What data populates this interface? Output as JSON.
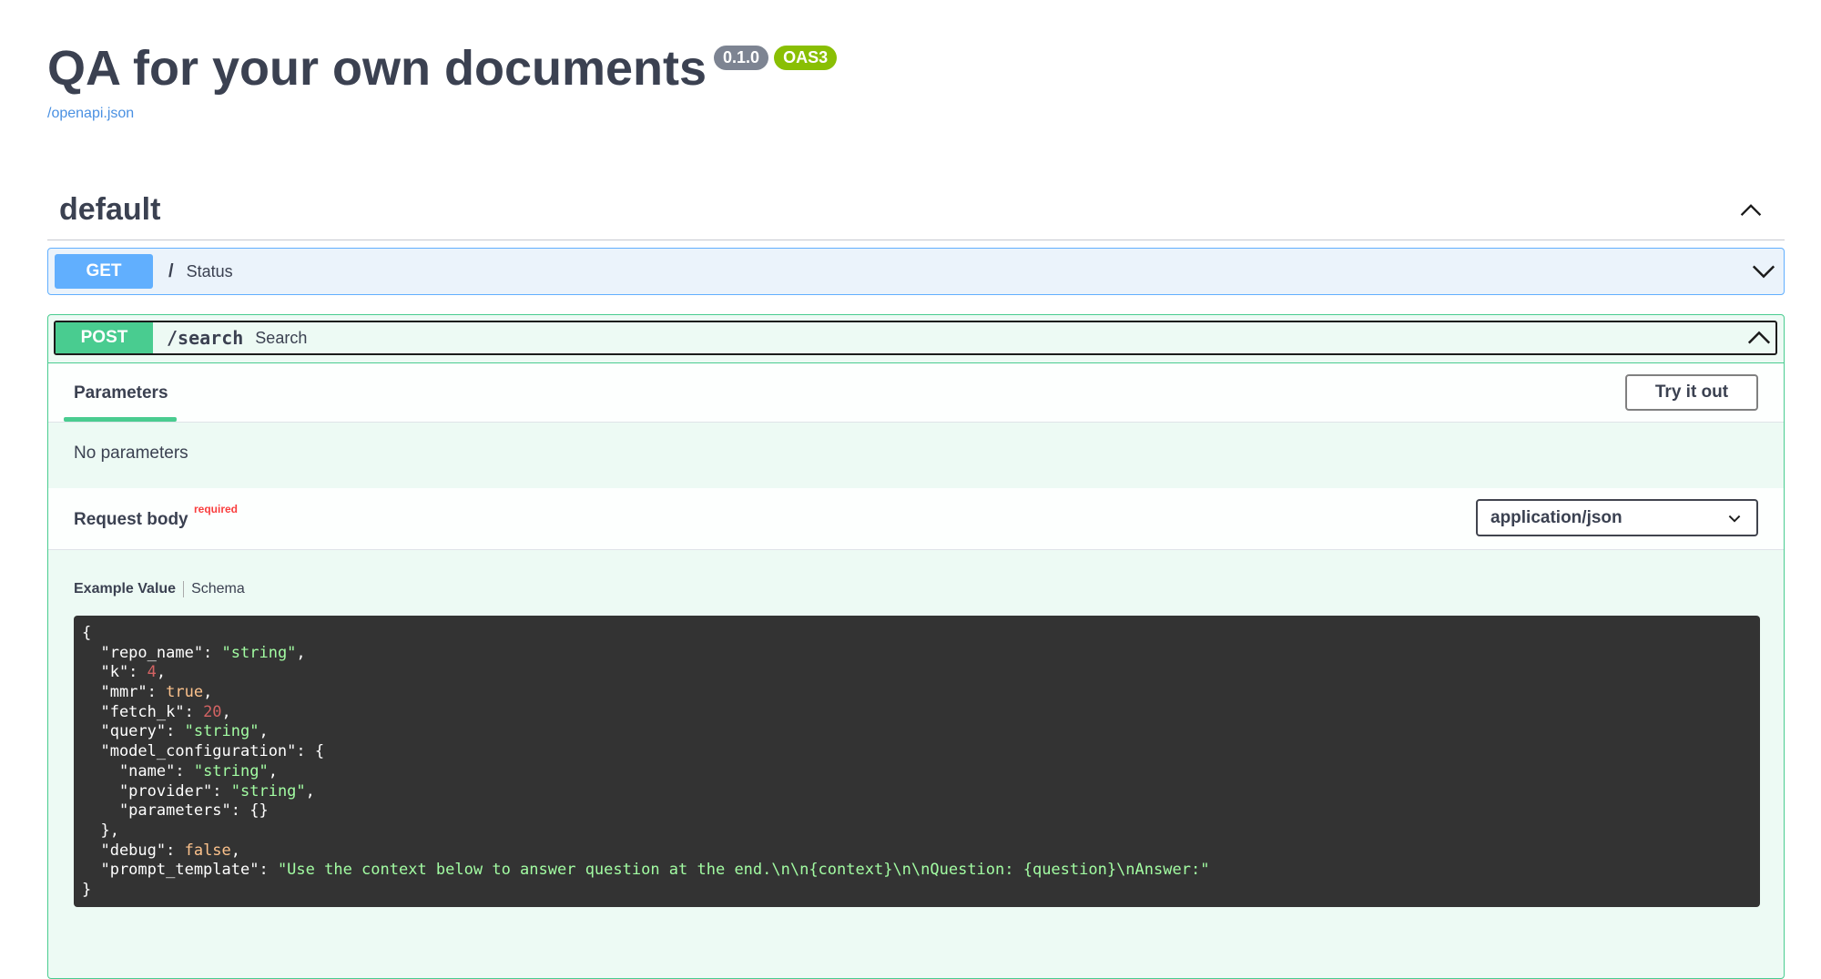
{
  "info": {
    "title": "QA for your own documents",
    "version": "0.1.0",
    "oas_badge": "OAS3",
    "spec_link": "/openapi.json"
  },
  "tag": {
    "name": "default"
  },
  "operations": [
    {
      "method": "GET",
      "path": "/",
      "summary": "Status",
      "expanded": false
    },
    {
      "method": "POST",
      "path": "/search",
      "summary": "Search",
      "expanded": true
    }
  ],
  "post_panel": {
    "params_tab": "Parameters",
    "try_button": "Try it out",
    "no_params": "No parameters",
    "request_body_title": "Request body",
    "required_label": "required",
    "content_type": "application/json",
    "example_tab": "Example Value",
    "schema_tab": "Schema",
    "example_lines": [
      [
        {
          "t": "{",
          "c": "k"
        }
      ],
      [
        {
          "t": "  \"repo_name\": ",
          "c": "k"
        },
        {
          "t": "\"string\"",
          "c": "s"
        },
        {
          "t": ",",
          "c": "k"
        }
      ],
      [
        {
          "t": "  \"k\": ",
          "c": "k"
        },
        {
          "t": "4",
          "c": "n"
        },
        {
          "t": ",",
          "c": "k"
        }
      ],
      [
        {
          "t": "  \"mmr\": ",
          "c": "k"
        },
        {
          "t": "true",
          "c": "b"
        },
        {
          "t": ",",
          "c": "k"
        }
      ],
      [
        {
          "t": "  \"fetch_k\": ",
          "c": "k"
        },
        {
          "t": "20",
          "c": "n"
        },
        {
          "t": ",",
          "c": "k"
        }
      ],
      [
        {
          "t": "  \"query\": ",
          "c": "k"
        },
        {
          "t": "\"string\"",
          "c": "s"
        },
        {
          "t": ",",
          "c": "k"
        }
      ],
      [
        {
          "t": "  \"model_configuration\": {",
          "c": "k"
        }
      ],
      [
        {
          "t": "    \"name\": ",
          "c": "k"
        },
        {
          "t": "\"string\"",
          "c": "s"
        },
        {
          "t": ",",
          "c": "k"
        }
      ],
      [
        {
          "t": "    \"provider\": ",
          "c": "k"
        },
        {
          "t": "\"string\"",
          "c": "s"
        },
        {
          "t": ",",
          "c": "k"
        }
      ],
      [
        {
          "t": "    \"parameters\": {}",
          "c": "k"
        }
      ],
      [
        {
          "t": "  },",
          "c": "k"
        }
      ],
      [
        {
          "t": "  \"debug\": ",
          "c": "k"
        },
        {
          "t": "false",
          "c": "b"
        },
        {
          "t": ",",
          "c": "k"
        }
      ],
      [
        {
          "t": "  \"prompt_template\": ",
          "c": "k"
        },
        {
          "t": "\"Use the context below to answer question at the end.\\n\\n{context}\\n\\nQuestion: {question}\\nAnswer:\"",
          "c": "s"
        }
      ],
      [
        {
          "t": "}",
          "c": "k"
        }
      ]
    ]
  },
  "icons": {
    "tag_toggle": "chevron-up-icon",
    "get_toggle": "chevron-down-icon",
    "post_toggle": "chevron-up-icon",
    "select_toggle": "chevron-down-icon"
  },
  "colors": {
    "get": "#61affe",
    "post": "#49cc90",
    "text": "#3b4151",
    "badge_version": "#7d8492",
    "badge_oas": "#89bf04",
    "required": "#f93e3e",
    "code_bg": "#333333"
  }
}
